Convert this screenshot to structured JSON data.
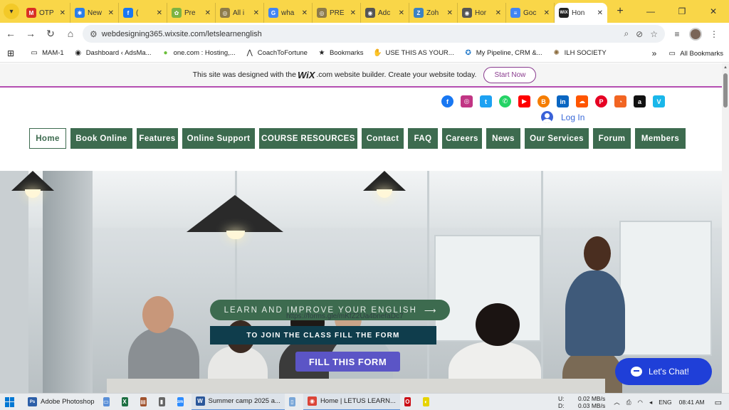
{
  "browser": {
    "tabs": [
      {
        "label": "OTP",
        "icon": "gmail-icon",
        "color": "#d93025",
        "glyph": "M"
      },
      {
        "label": "New",
        "icon": "bolt-icon",
        "color": "#2b7de9",
        "glyph": "✱"
      },
      {
        "label": "(",
        "icon": "facebook-icon",
        "color": "#1877f2",
        "glyph": "f"
      },
      {
        "label": "Pre",
        "icon": "leaf-icon",
        "color": "#7cb342",
        "glyph": "✿"
      },
      {
        "label": "All i",
        "icon": "seal-icon",
        "color": "#8d7b4a",
        "glyph": "◎"
      },
      {
        "label": "wha",
        "icon": "google-icon",
        "color": "#4285f4",
        "glyph": "G"
      },
      {
        "label": "PRE",
        "icon": "seal-icon",
        "color": "#8d7b4a",
        "glyph": "◎"
      },
      {
        "label": "Adc",
        "icon": "globe-icon",
        "color": "#555555",
        "glyph": "◉"
      },
      {
        "label": "Zoh",
        "icon": "zoho-icon",
        "color": "#3b82c4",
        "glyph": "Z"
      },
      {
        "label": "Hor",
        "icon": "globe-icon",
        "color": "#555555",
        "glyph": "◉"
      },
      {
        "label": "Goc",
        "icon": "google-docs-icon",
        "color": "#4285f4",
        "glyph": "≡"
      },
      {
        "label": "Hon",
        "icon": "wix-icon",
        "color": "#222222",
        "glyph": "WiX",
        "active": true
      }
    ],
    "url": "webdesigning365.wixsite.com/letslearnenglish",
    "bookmarks": [
      {
        "label": "MAM-1",
        "icon": "folder-icon"
      },
      {
        "label": "Dashboard ‹ AdsMa...",
        "icon": "globe-icon"
      },
      {
        "label": "one.com : Hosting,...",
        "icon": "circle-icon"
      },
      {
        "label": "CoachToFortune",
        "icon": "logo-icon"
      },
      {
        "label": "Bookmarks",
        "icon": "star-icon"
      },
      {
        "label": "USE THIS AS YOUR...",
        "icon": "hand-icon"
      },
      {
        "label": "My Pipeline, CRM &...",
        "icon": "crm-icon"
      },
      {
        "label": "ILH SOCIETY",
        "icon": "seal-icon"
      }
    ],
    "all_bookmarks": "All Bookmarks"
  },
  "wix_banner": {
    "text_before": "This site was designed with the",
    "logo": "WiX",
    "text_after": ".com website builder. Create your website today.",
    "button": "Start Now"
  },
  "site": {
    "login": "Log In",
    "menu": [
      {
        "label": "Home",
        "width": 52,
        "active": true
      },
      {
        "label": "Book Online",
        "width": 87
      },
      {
        "label": "Features",
        "width": 58
      },
      {
        "label": "Online Support",
        "width": 102
      },
      {
        "label": "COURSE RESOURCES",
        "width": 138
      },
      {
        "label": "Contact",
        "width": 59
      },
      {
        "label": "FAQ",
        "width": 42
      },
      {
        "label": "Careers",
        "width": 56
      },
      {
        "label": "News",
        "width": 48
      },
      {
        "label": "Our Services",
        "width": 90
      },
      {
        "label": "Forum",
        "width": 53
      },
      {
        "label": "Members",
        "width": 71
      }
    ],
    "social": [
      {
        "icon": "facebook-icon",
        "color": "#1877f2",
        "glyph": "f",
        "round": true
      },
      {
        "icon": "instagram-icon",
        "color": "#c13584",
        "glyph": "◎"
      },
      {
        "icon": "twitter-icon",
        "color": "#1da1f2",
        "glyph": "t"
      },
      {
        "icon": "whatsapp-icon",
        "color": "#25d366",
        "glyph": "✆",
        "round": true
      },
      {
        "icon": "youtube-icon",
        "color": "#ff0000",
        "glyph": "▶"
      },
      {
        "icon": "blogger-icon",
        "color": "#f57d00",
        "glyph": "B",
        "round": true
      },
      {
        "icon": "linkedin-icon",
        "color": "#0a66c2",
        "glyph": "in"
      },
      {
        "icon": "soundcloud-icon",
        "color": "#ff5500",
        "glyph": "☁"
      },
      {
        "icon": "pinterest-icon",
        "color": "#e60023",
        "glyph": "P",
        "round": true
      },
      {
        "icon": "rss-icon",
        "color": "#f26522",
        "glyph": "◔"
      },
      {
        "icon": "amazon-icon",
        "color": "#111111",
        "glyph": "a"
      },
      {
        "icon": "vimeo-icon",
        "color": "#1ab7ea",
        "glyph": "V"
      }
    ],
    "hero": {
      "learn_button": "LEARN AND IMPROVE YOUR ENGLISH",
      "arrow": "⟶",
      "form_url": "https://forms.gle/mKfZ2Ua4bnefaDc7",
      "join_text": "TO JOIN THE CLASS FILL THE FORM",
      "fill_button": "FILL THIS FORM"
    },
    "chat": "Let's Chat!"
  },
  "taskbar": {
    "items": [
      {
        "label": "Adobe Photoshop",
        "icon": "photoshop-icon",
        "color": "#2d5fa8",
        "glyph": "Ps"
      },
      {
        "label": "",
        "icon": "desktop-icon",
        "color": "#5a8fd8",
        "glyph": "▭"
      },
      {
        "label": "",
        "icon": "excel-icon",
        "color": "#1d6f42",
        "glyph": "X"
      },
      {
        "label": "",
        "icon": "archive-icon",
        "color": "#a0522d",
        "glyph": "▤"
      },
      {
        "label": "",
        "icon": "usb-icon",
        "color": "#666666",
        "glyph": "▮"
      },
      {
        "label": "",
        "icon": "zoom-icon",
        "color": "#2d8cff",
        "glyph": "zm"
      },
      {
        "label": "Summer camp 2025 a...",
        "icon": "word-icon",
        "color": "#2b579a",
        "glyph": "W",
        "open": true
      },
      {
        "label": "",
        "icon": "file-icon",
        "color": "#7aa7d8",
        "glyph": "▯"
      },
      {
        "label": "Home | LETUS LEARN...",
        "icon": "chrome-icon",
        "color": "#db4437",
        "glyph": "◉",
        "open": true
      },
      {
        "label": "",
        "icon": "opera-icon",
        "color": "#cc0f16",
        "glyph": "O"
      },
      {
        "label": "",
        "icon": "snapchat-icon",
        "color": "#e6d300",
        "glyph": "◐"
      }
    ],
    "net_up": "0.02 MB/s",
    "net_down": "0.03 MB/s",
    "net_up_label": "U:",
    "net_down_label": "D:",
    "lang": "ENG",
    "time": "08:41 AM"
  }
}
